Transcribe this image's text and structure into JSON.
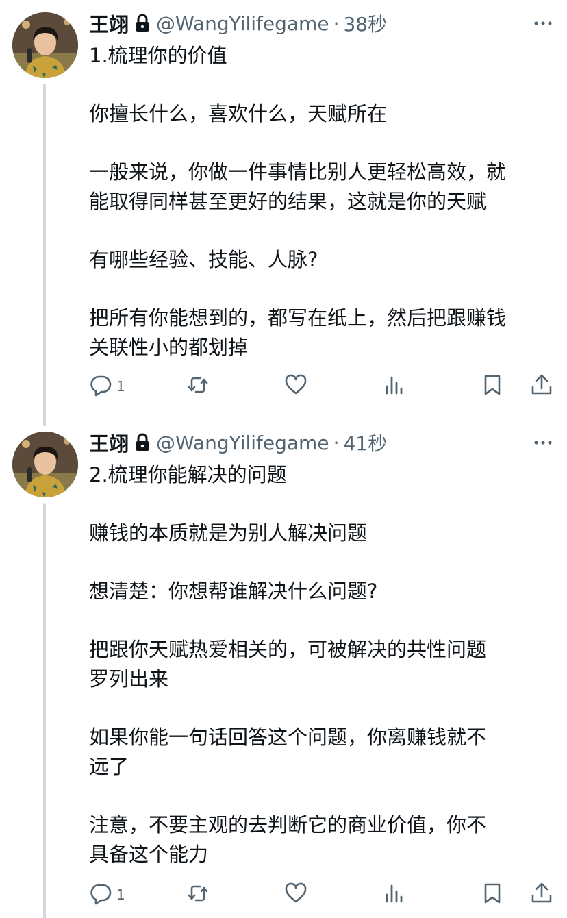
{
  "tweets": [
    {
      "name": "王翊",
      "handle": "@WangYilifegame",
      "separator": "·",
      "time": "38秒",
      "paragraphs": [
        "1.梳理你的价值",
        "你擅长什么，喜欢什么，天赋所在",
        "一般来说，你做一件事情比别人更轻松高效，就\n能取得同样甚至更好的结果，这就是你的天赋",
        "有哪些经验、技能、人脉?",
        "把所有你能想到的，都写在纸上，然后把跟赚钱\n关联性小的都划掉"
      ],
      "reply_count": "1"
    },
    {
      "name": "王翊",
      "handle": "@WangYilifegame",
      "separator": "·",
      "time": "41秒",
      "paragraphs": [
        "2.梳理你能解决的问题",
        "赚钱的本质就是为别人解决问题",
        "想清楚：你想帮谁解决什么问题?",
        "把跟你天赋热爱相关的，可被解决的共性问题\n罗列出来",
        "如果你能一句话回答这个问题，你离赚钱就不\n远了",
        "注意，不要主观的去判断它的商业价值，你不\n具备这个能力"
      ],
      "reply_count": "1"
    }
  ],
  "icons": {
    "lock": "lock-icon",
    "more": "more-icon",
    "reply": "reply-icon",
    "retweet": "retweet-icon",
    "like": "like-icon",
    "views": "views-icon",
    "bookmark": "bookmark-icon",
    "share": "share-icon"
  },
  "colors": {
    "text": "#0f1419",
    "secondary": "#536471",
    "thread_line": "#cfd9de"
  }
}
